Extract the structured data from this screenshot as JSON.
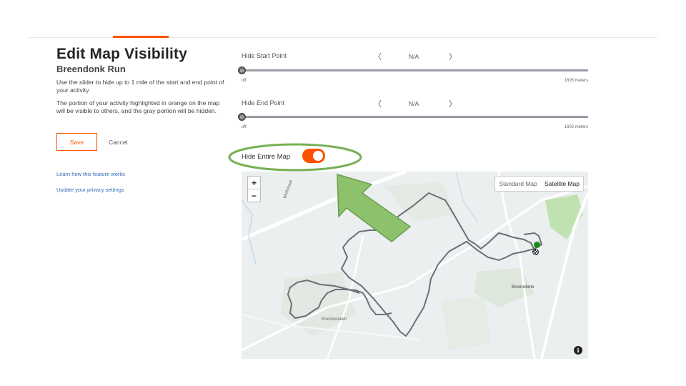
{
  "page": {
    "title": "Edit Map Visibility",
    "activity_name": "Breendonk Run",
    "description_1": "Use the slider to hide up to 1 mile of the start and end point of your activity.",
    "description_2": "The portion of your activity highlighted in orange on the map will be visible to others, and the gray portion will be hidden."
  },
  "actions": {
    "save_label": "Save",
    "cancel_label": "Cancel"
  },
  "links": {
    "learn": "Learn how this feature works",
    "privacy": "Update your privacy settings"
  },
  "sliders": {
    "start": {
      "label": "Hide Start Point",
      "value": "N/A",
      "min_label": "off",
      "max_label": "1605 meters",
      "prev": "〈",
      "next": "〉"
    },
    "end": {
      "label": "Hide End Point",
      "value": "N/A",
      "min_label": "off",
      "max_label": "1605 meters",
      "prev": "〈",
      "next": "〉"
    }
  },
  "hide_map": {
    "label": "Hide Entire Map",
    "enabled": true
  },
  "map": {
    "zoom_in": "+",
    "zoom_out": "−",
    "standard_label": "Standard Map",
    "satellite_label": "Satellite Map",
    "info": "i",
    "places": {
      "town": "Breendonk",
      "street_1": "Kruisbroeken",
      "street_2": "Wolfstraat"
    }
  },
  "colors": {
    "accent": "#fc5200",
    "route": "#6e6e78",
    "annotation": "#76b054",
    "start_marker": "#1a8a1a"
  }
}
